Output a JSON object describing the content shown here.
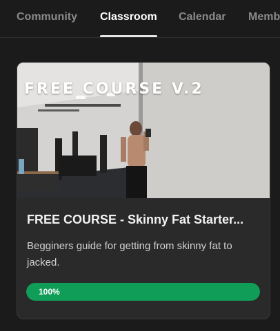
{
  "tabs": [
    {
      "label": "Community",
      "active": false
    },
    {
      "label": "Classroom",
      "active": true
    },
    {
      "label": "Calendar",
      "active": false
    },
    {
      "label": "Members",
      "active": false
    }
  ],
  "course": {
    "banner_text": "FREE COURSE V.2",
    "title": "FREE COURSE - Skinny Fat Starter...",
    "description": "Begginers guide for getting from skinny fat to jacked.",
    "progress_label": "100%",
    "progress_fraction": 1.0
  },
  "colors": {
    "accent_green": "#0f9d58",
    "background": "#1b1b1b",
    "card": "#2a2a2a"
  }
}
